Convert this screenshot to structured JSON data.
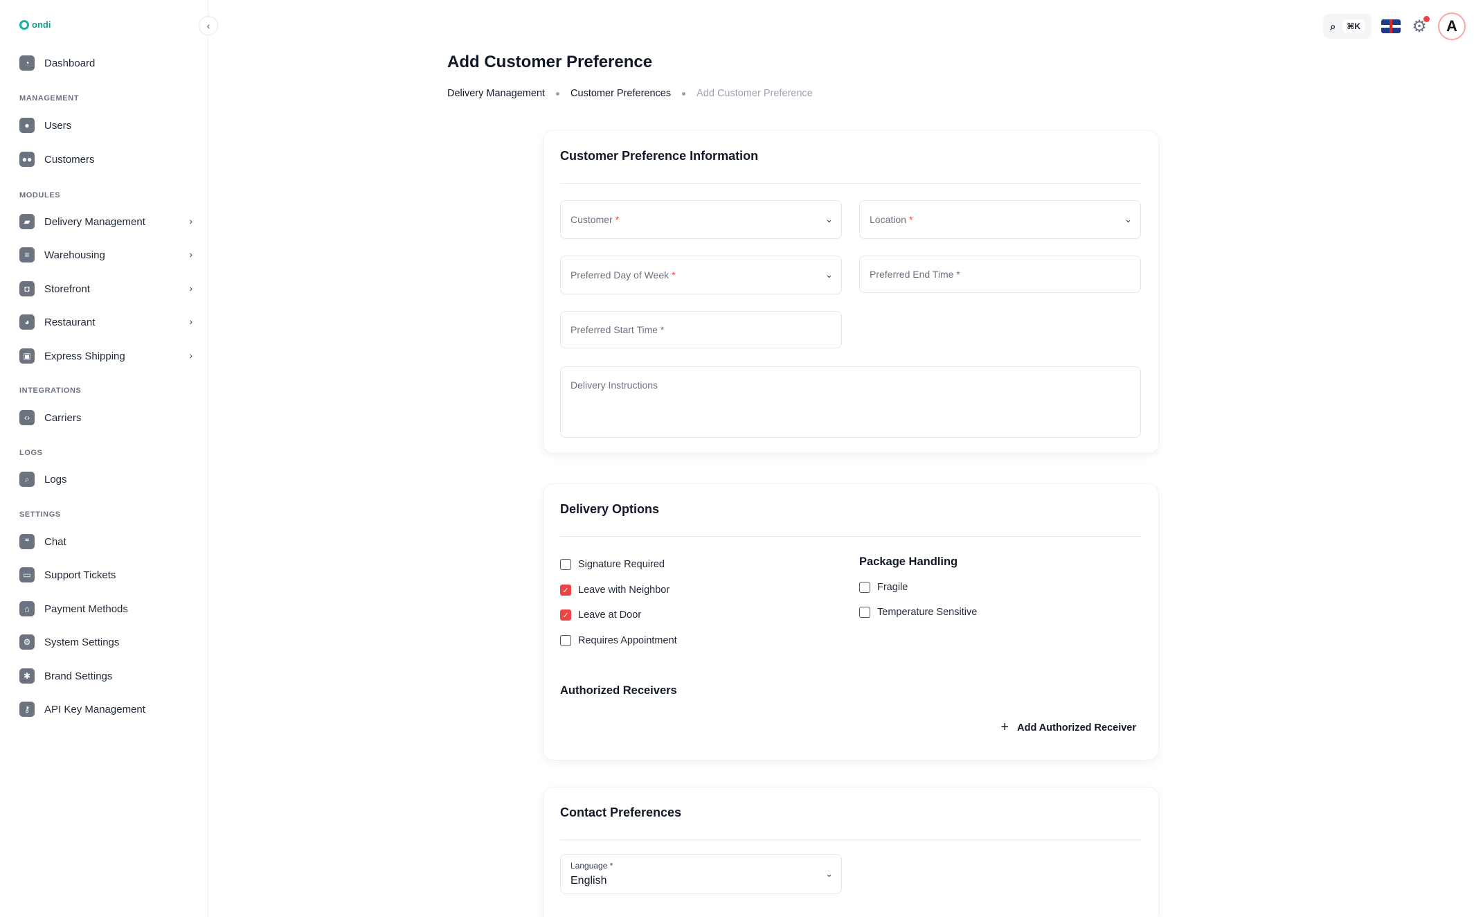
{
  "brand": {
    "logo_text": "ondi"
  },
  "sidebar": {
    "dashboard": "Dashboard",
    "sections": {
      "management": "MANAGEMENT",
      "modules": "MODULES",
      "integrations": "INTEGRATIONS",
      "logs": "LOGS",
      "settings": "SETTINGS"
    },
    "items": {
      "users": "Users",
      "customers": "Customers",
      "delivery_management": "Delivery Management",
      "warehousing": "Warehousing",
      "storefront": "Storefront",
      "restaurant": "Restaurant",
      "express_shipping": "Express Shipping",
      "carriers": "Carriers",
      "logs": "Logs",
      "chat": "Chat",
      "support_tickets": "Support Tickets",
      "payment_methods": "Payment Methods",
      "system_settings": "System Settings",
      "brand_settings": "Brand Settings",
      "api_key_management": "API Key Management"
    }
  },
  "topbar": {
    "shortcut": "⌘K",
    "avatar_letter": "A"
  },
  "page": {
    "title": "Add Customer Preference",
    "breadcrumb": [
      "Delivery Management",
      "Customer Preferences",
      "Add Customer Preference"
    ]
  },
  "info_card": {
    "title": "Customer Preference Information",
    "customer_placeholder": "Customer",
    "location_placeholder": "Location",
    "preferred_day_placeholder": "Preferred Day of Week",
    "preferred_end_time_placeholder": "Preferred End Time *",
    "preferred_start_time_placeholder": "Preferred Start Time *",
    "delivery_instructions_placeholder": "Delivery Instructions",
    "required_mark": "*"
  },
  "delivery_options": {
    "title": "Delivery Options",
    "signature_required": "Signature Required",
    "leave_with_neighbor": "Leave with Neighbor",
    "leave_at_door": "Leave at Door",
    "requires_appointment": "Requires Appointment",
    "package_handling_title": "Package Handling",
    "fragile": "Fragile",
    "temperature_sensitive": "Temperature Sensitive",
    "authorized_receivers_title": "Authorized Receivers",
    "add_authorized_receiver": "Add Authorized Receiver",
    "checked": {
      "signature_required": false,
      "leave_with_neighbor": true,
      "leave_at_door": true,
      "requires_appointment": false,
      "fragile": false,
      "temperature_sensitive": false
    }
  },
  "contact_preferences": {
    "title": "Contact Preferences",
    "language_label": "Language *",
    "language_value": "English"
  },
  "colors": {
    "accent": "#ef4444",
    "brand": "#12b3a1"
  }
}
